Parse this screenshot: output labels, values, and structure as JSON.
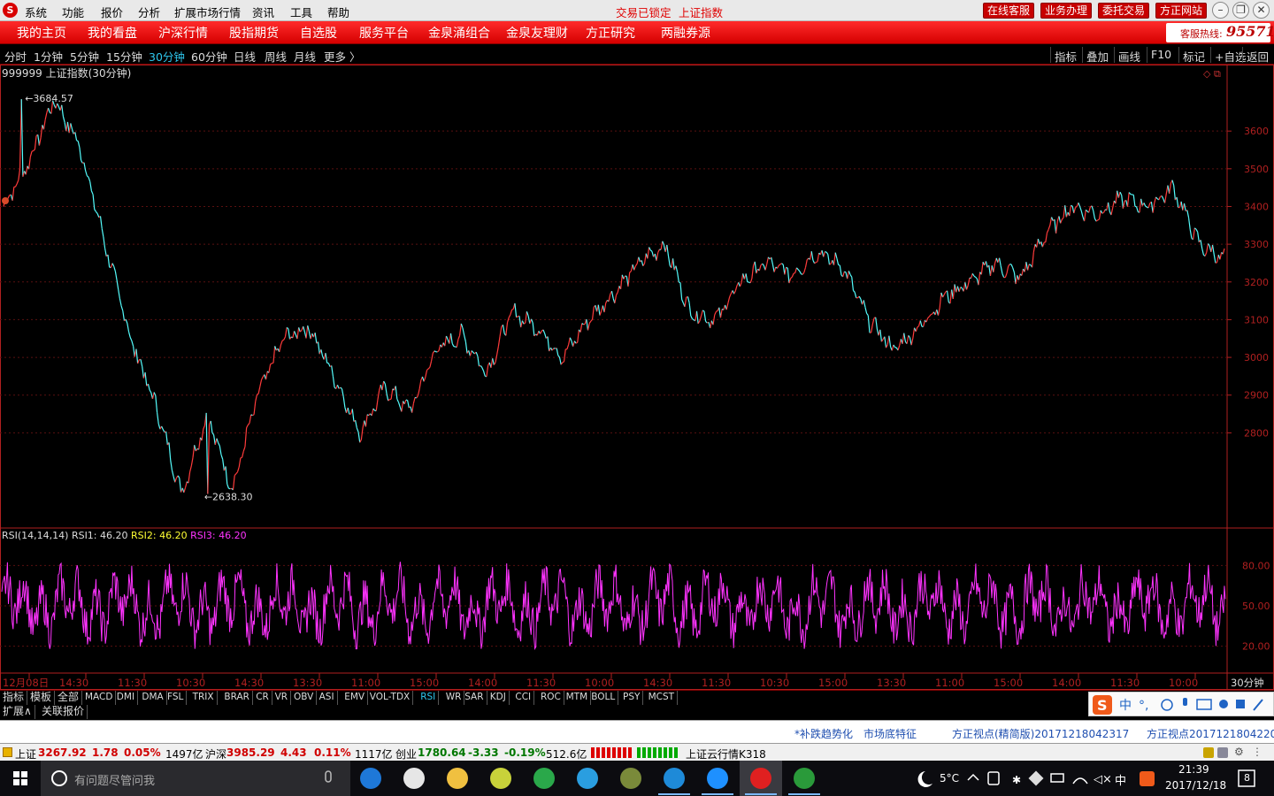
{
  "menubar": {
    "items": [
      "系统",
      "功能",
      "报价",
      "分析",
      "扩展市场行情",
      "资讯",
      "工具",
      "帮助"
    ],
    "status": "交易已锁定",
    "index_name": "上证指数",
    "buttons": [
      "在线客服",
      "业务办理",
      "委托交易",
      "方正网站"
    ]
  },
  "navbar": {
    "items": [
      "我的主页",
      "我的看盘",
      "沪深行情",
      "股指期货",
      "自选股",
      "服务平台",
      "金泉涌组合",
      "金泉友理财",
      "方正研究",
      "两融券源"
    ],
    "hotline_label": "客服热线:",
    "hotline_number": "95571"
  },
  "periodbar": {
    "periods": [
      "分时",
      "1分钟",
      "5分钟",
      "15分钟",
      "30分钟",
      "60分钟",
      "日线",
      "周线",
      "月线",
      "更多 〉"
    ],
    "active": "30分钟",
    "tools": [
      "指标",
      "叠加",
      "画线",
      "F10",
      "标记",
      "+自选",
      "返回"
    ]
  },
  "chart_data": {
    "type": "line",
    "title": "999999 上证指数(30分钟)",
    "ylim": [
      2550,
      3720
    ],
    "y_ticks": [
      3600,
      3500,
      3400,
      3300,
      3200,
      3100,
      3000,
      2900,
      2800
    ],
    "high_label": "3684.57",
    "low_label": "2638.30",
    "x_ticks": [
      "12月08日",
      "14:30",
      "11:30",
      "10:30",
      "14:30",
      "13:30",
      "11:00",
      "15:00",
      "14:00",
      "11:30",
      "10:00",
      "14:30",
      "11:30",
      "10:30",
      "15:00",
      "13:30",
      "11:00",
      "15:00",
      "14:00",
      "11:30",
      "10:00"
    ],
    "period_label": "30分钟",
    "anchors": [
      [
        0,
        3400
      ],
      [
        1.5,
        3520
      ],
      [
        3,
        3684
      ],
      [
        4,
        3560
      ],
      [
        5,
        3300
      ],
      [
        6,
        3050
      ],
      [
        7,
        2870
      ],
      [
        8,
        2638
      ],
      [
        9,
        2850
      ],
      [
        10,
        2650
      ],
      [
        11,
        2900
      ],
      [
        12,
        3050
      ],
      [
        13,
        3080
      ],
      [
        14,
        2950
      ],
      [
        15,
        2800
      ],
      [
        16,
        2920
      ],
      [
        17,
        2860
      ],
      [
        18,
        3020
      ],
      [
        19,
        3060
      ],
      [
        20,
        2960
      ],
      [
        21,
        3120
      ],
      [
        22,
        3080
      ],
      [
        23,
        3000
      ],
      [
        24,
        3100
      ],
      [
        25,
        3170
      ],
      [
        26,
        3250
      ],
      [
        27,
        3300
      ],
      [
        28,
        3120
      ],
      [
        29,
        3100
      ],
      [
        30,
        3200
      ],
      [
        31,
        3250
      ],
      [
        32,
        3220
      ],
      [
        33,
        3280
      ],
      [
        34,
        3240
      ],
      [
        35,
        3100
      ],
      [
        36,
        3020
      ],
      [
        37,
        3080
      ],
      [
        38,
        3160
      ],
      [
        39,
        3200
      ],
      [
        40,
        3250
      ],
      [
        41,
        3210
      ],
      [
        42,
        3330
      ],
      [
        43,
        3400
      ],
      [
        44,
        3380
      ],
      [
        45,
        3420
      ],
      [
        46,
        3400
      ],
      [
        47,
        3450
      ],
      [
        48,
        3300
      ],
      [
        49,
        3260
      ]
    ],
    "rsi": {
      "label": "RSI(14,14,14)",
      "series": [
        {
          "name": "RSI1",
          "value": "46.20"
        },
        {
          "name": "RSI2",
          "value": "46.20"
        },
        {
          "name": "RSI3",
          "value": "46.20"
        }
      ],
      "ylim": [
        0,
        100
      ],
      "y_ticks": [
        80,
        50,
        20
      ]
    }
  },
  "indicators": [
    "指标",
    "模板",
    "全部",
    "MACD",
    "DMI",
    "DMA",
    "FSL",
    "TRIX",
    "BRAR",
    "CR",
    "VR",
    "OBV",
    "ASI",
    "EMV",
    "VOL-TDX",
    "RSI",
    "WR",
    "SAR",
    "KDJ",
    "CCI",
    "ROC",
    "MTM",
    "BOLL",
    "PSY",
    "MCST"
  ],
  "active_indicator": "RSI",
  "ext_tabs": [
    "扩展∧",
    "关联报价"
  ],
  "news": [
    "*补跌趋势化",
    "市场底特征",
    "方正视点(精简版)20171218042317",
    "方正视点20171218042209"
  ],
  "status": {
    "sh_label": "上证",
    "sh_value": "3267.92",
    "sh_change": "1.78",
    "sh_pct": "0.05%",
    "sh_amount": "1497亿",
    "hs_label": "沪深",
    "hs_value": "3985.29",
    "hs_change": "4.43",
    "hs_pct": "0.11%",
    "hs_amount": "1117亿",
    "cy_label": "创业",
    "cy_value": "1780.64",
    "cy_change": "-3.33",
    "cy_pct": "-0.19%",
    "cy_amount": "512.6亿",
    "cloud": "上证云行情K318"
  },
  "taskbar": {
    "search_placeholder": "有问题尽管问我",
    "temperature": "5°C",
    "ime": "中",
    "time": "21:39",
    "date": "2017/12/18",
    "notifications": "8"
  },
  "colors": {
    "up": "#ff3b3b",
    "down": "#54fcfc",
    "rsi": "#ff33ff",
    "axis": "#b02020",
    "brand": "#e00000"
  }
}
